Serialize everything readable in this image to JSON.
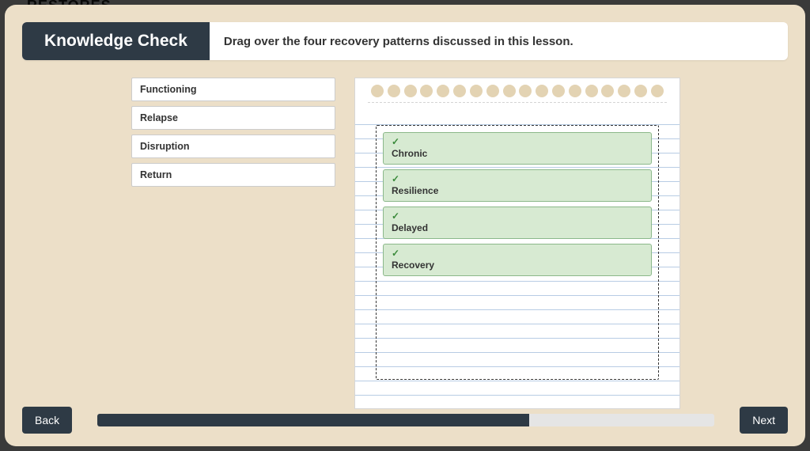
{
  "brand_hint": "RESTORES",
  "header": {
    "title": "Knowledge Check",
    "instruction": "Drag over the four recovery patterns discussed in this lesson."
  },
  "source_items": [
    {
      "label": "Functioning"
    },
    {
      "label": "Relapse"
    },
    {
      "label": "Disruption"
    },
    {
      "label": "Return"
    }
  ],
  "dropped_items": [
    {
      "label": "Chronic",
      "correct": true
    },
    {
      "label": "Resilience",
      "correct": true
    },
    {
      "label": "Delayed",
      "correct": true
    },
    {
      "label": "Recovery",
      "correct": true
    }
  ],
  "footer": {
    "back_label": "Back",
    "next_label": "Next",
    "progress_percent": 70
  },
  "colors": {
    "stage_bg": "#ecdfc8",
    "header_dark": "#2e3a45",
    "correct_bg": "#d7ead2",
    "correct_border": "#8bb88a"
  }
}
